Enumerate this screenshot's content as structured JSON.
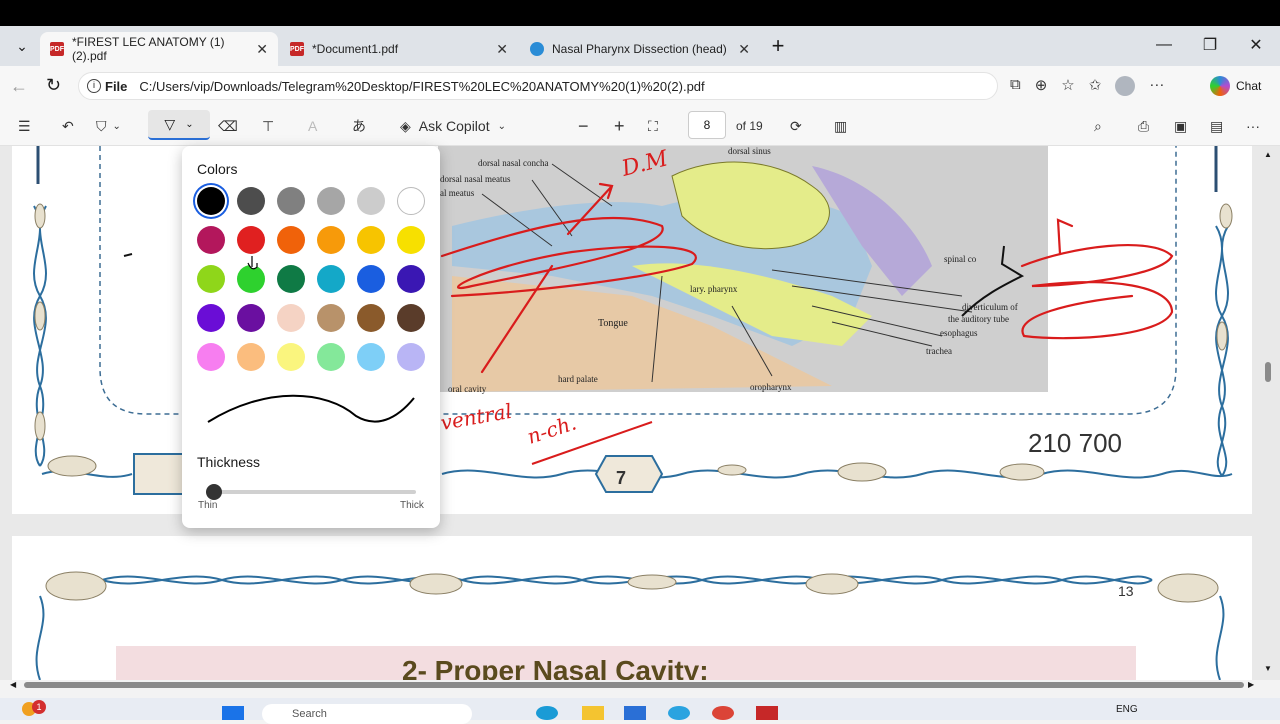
{
  "tabs": [
    {
      "label": "*FIREST LEC ANATOMY (1) (2).pdf",
      "close": "✕"
    },
    {
      "label": "*Document1.pdf",
      "close": "✕"
    },
    {
      "label": "Nasal Pharynx Dissection (head)",
      "close": "✕"
    }
  ],
  "address": {
    "file_label": "File",
    "url": "C:/Users/vip/Downloads/Telegram%20Desktop/FIREST%20LEC%20ANATOMY%20(1)%20(2).pdf",
    "chat_label": "Chat"
  },
  "toolbar": {
    "ask_copilot": "Ask Copilot",
    "page_number": "8",
    "page_total": "of 19"
  },
  "popup": {
    "colors_title": "Colors",
    "thickness_title": "Thickness",
    "thin_label": "Thin",
    "thick_label": "Thick",
    "thickness_value": 0.0,
    "selected_color": "#000000",
    "colors": [
      "#000000",
      "#4d4d4d",
      "#808080",
      "#a6a6a6",
      "#cccccc",
      "#ffffff",
      "#b3175c",
      "#e02020",
      "#f0620a",
      "#f79a0a",
      "#f7c400",
      "#f7e000",
      "#8fd61a",
      "#2ed12e",
      "#0f7a45",
      "#14a8c8",
      "#1a5ee0",
      "#3a17b3",
      "#6a0dd6",
      "#6a0fa0",
      "#f5d3c4",
      "#b8926a",
      "#8a5a2b",
      "#5a3c2a",
      "#f77ef0",
      "#fbbd7e",
      "#faf57e",
      "#84e89a",
      "#7ecff7",
      "#b9b5f5"
    ]
  },
  "document": {
    "labels": {
      "dorsal_concha": "dorsal nasal concha",
      "dorsal_meatus": "dorsal nasal meatus",
      "nasal_meatus": "al meatus",
      "tongue": "Tongue",
      "hard_palate": "hard palate",
      "oral_cavity": "oral cavity",
      "oropharynx": "oropharynx",
      "laryngopharynx": "lary. pharynx",
      "spinal_cord": "spinal co",
      "diverticulum": "diverticulum of",
      "auditory_tube": "the auditory tube",
      "esophagus": "esophagus",
      "trachea": "trachea",
      "dorsal_sinus": "dorsal sinus"
    },
    "handwriting": {
      "dm": "D.M",
      "ventral": "ventral",
      "nch": "n-ch."
    },
    "page_number_badge": "7",
    "partial_number": "210 700",
    "corner_mark": "13",
    "heading": "2- Proper Nasal Cavity:"
  },
  "taskbar": {
    "notification_count": "1",
    "search": "Search",
    "lang": "ENG"
  }
}
